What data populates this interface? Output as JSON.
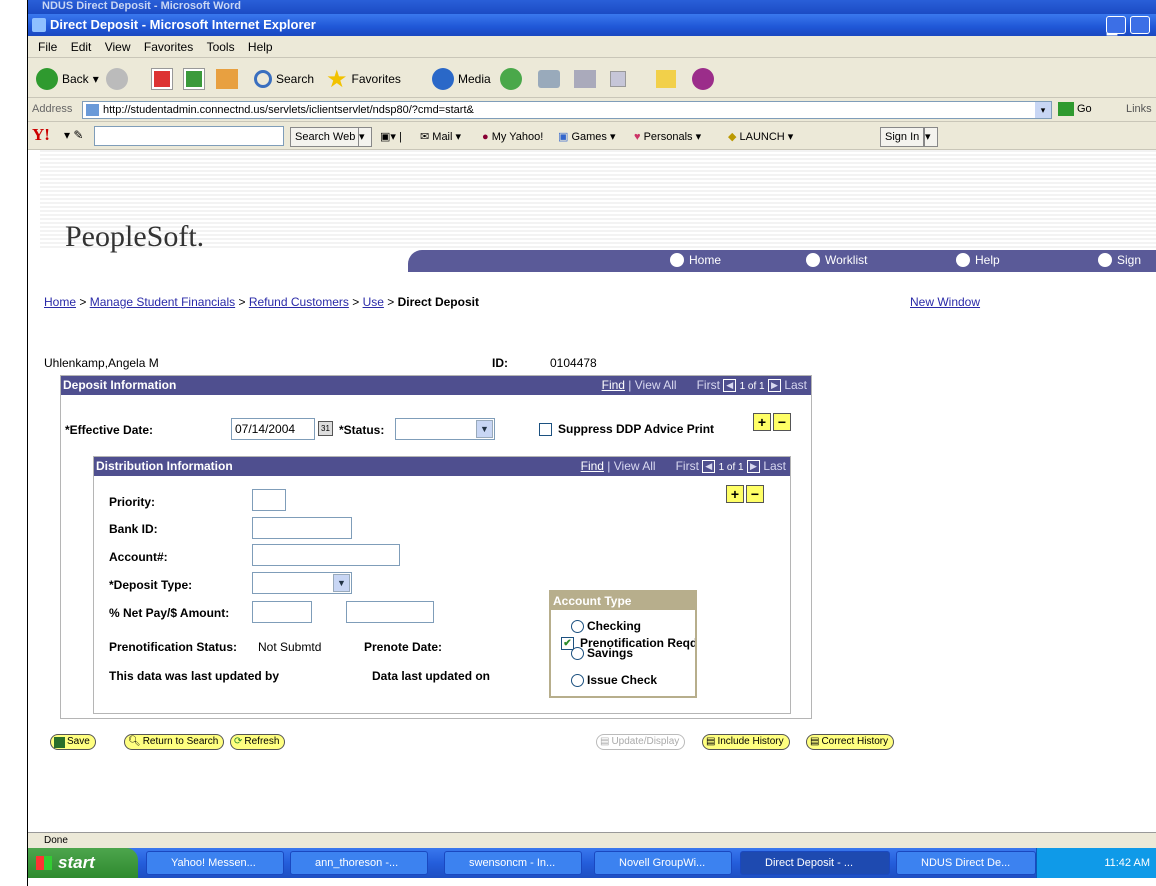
{
  "word_window": {
    "title": "NDUS Direct Deposit - Microsoft Word"
  },
  "ie_window": {
    "title": "Direct Deposit - Microsoft Internet Explorer"
  },
  "menu": [
    "File",
    "Edit",
    "View",
    "Favorites",
    "Tools",
    "Help"
  ],
  "toolbar": {
    "back": "Back",
    "search": "Search",
    "favorites": "Favorites",
    "media": "Media"
  },
  "address": {
    "label": "Address",
    "url": "http://studentadmin.connectnd.us/servlets/iclientservlet/ndsp80/?cmd=start&",
    "go": "Go",
    "links": "Links"
  },
  "yahoo": {
    "search_web": "Search Web",
    "mail": "Mail",
    "my_yahoo": "My Yahoo!",
    "games": "Games",
    "personals": "Personals",
    "launch": "LAUNCH",
    "sign_in": "Sign In"
  },
  "ps": {
    "logo": "PeopleSoft.",
    "nav": {
      "home": "Home",
      "worklist": "Worklist",
      "help": "Help",
      "sign": "Sign"
    },
    "breadcrumb": {
      "home": "Home",
      "manage": "Manage Student Financials",
      "refund": "Refund Customers",
      "use": "Use",
      "current": "Direct Deposit",
      "sep": " > "
    },
    "new_window": "New Window",
    "name": "Uhlenkamp,Angela M",
    "id_label": "ID:",
    "id_value": "0104478"
  },
  "deposit": {
    "header": "Deposit Information",
    "find": "Find",
    "view_all": "View All",
    "first": "First",
    "count": "1 of 1",
    "last": "Last",
    "effective_date_label": "*Effective Date:",
    "effective_date_value": "07/14/2004",
    "status_label": "*Status:",
    "status_value": "",
    "suppress_label": "Suppress DDP Advice Print",
    "suppress_checked": false
  },
  "distribution": {
    "header": "Distribution Information",
    "find": "Find",
    "view_all": "View All",
    "first": "First",
    "count": "1 of 1",
    "last": "Last",
    "priority_label": "Priority:",
    "priority_value": "",
    "bank_id_label": "Bank ID:",
    "bank_id_value": "",
    "account_label": "Account#:",
    "account_value": "",
    "deposit_type_label": "*Deposit Type:",
    "deposit_type_value": "",
    "net_pay_label": "% Net Pay/$ Amount:",
    "net_pay_value": "",
    "amount_value": "",
    "prenote_status_label": "Prenotification Status:",
    "prenote_status_value": "Not Submtd",
    "prenote_date_label": "Prenote Date:",
    "prenote_reqd_label": "Prenotification Reqd",
    "prenote_reqd_checked": true,
    "last_updated_by_label": "This data was last updated by",
    "last_updated_on_label": "Data last updated on",
    "account_type": {
      "header": "Account Type",
      "options": [
        "Checking",
        "Savings",
        "Issue Check"
      ],
      "selected": null
    }
  },
  "buttons": {
    "save": "Save",
    "return": "Return to Search",
    "refresh": "Refresh",
    "update": "Update/Display",
    "include": "Include History",
    "correct": "Correct History"
  },
  "status_bar": "Done",
  "taskbar": {
    "start": "start",
    "tasks": [
      "Yahoo! Messen...",
      "ann_thoreson -...",
      "swensoncm - In...",
      "Novell GroupWi...",
      "Direct Deposit - ...",
      "NDUS Direct De..."
    ],
    "active_index": 4,
    "clock": "11:42 AM"
  },
  "colors": {
    "ps_header": "#4f4f8f",
    "xp_blue": "#245edb",
    "prompt_yellow": "#ffff66"
  }
}
